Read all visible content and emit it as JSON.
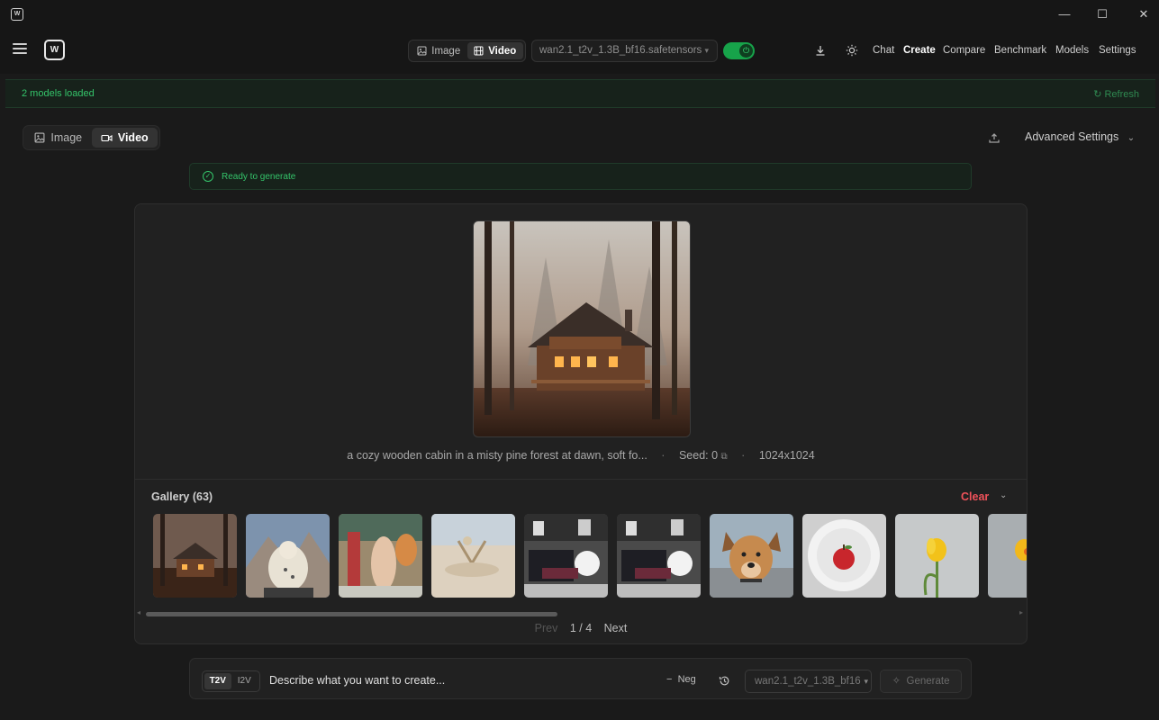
{
  "window": {
    "minimize": "—",
    "maximize": "☐",
    "close": "✕"
  },
  "brand": {
    "logo_text": "W"
  },
  "topnav": {
    "mode_tabs": [
      {
        "label": "Image"
      },
      {
        "label": "Video",
        "active": true
      }
    ],
    "model": "wan2.1_t2v_1.3B_bf16.safetensors",
    "power_on": true,
    "links": [
      {
        "label": "Chat"
      },
      {
        "label": "Create",
        "active": true
      },
      {
        "label": "Compare"
      },
      {
        "label": "Benchmark"
      },
      {
        "label": "Models"
      },
      {
        "label": "Settings"
      }
    ]
  },
  "status": {
    "message": "2 models loaded",
    "refresh_label": "Refresh"
  },
  "subbar": {
    "tabs": [
      {
        "label": "Image"
      },
      {
        "label": "Video",
        "active": true
      }
    ],
    "advanced_settings": "Advanced Settings"
  },
  "ready": {
    "message": "Ready to generate"
  },
  "preview": {
    "prompt": "a cozy wooden cabin in a misty pine forest at dawn, soft fo...",
    "seed_label": "Seed: 0",
    "resolution": "1024x1024"
  },
  "gallery": {
    "title": "Gallery (63)",
    "clear_label": "Clear",
    "pagination": {
      "prev": "Prev",
      "page": "1 / 4",
      "next": "Next"
    }
  },
  "prompt_bar": {
    "modes": [
      {
        "label": "T2V",
        "active": true
      },
      {
        "label": "I2V"
      }
    ],
    "placeholder": "Describe what you want to create...",
    "neg_label": "Neg",
    "model": "wan2.1_t2v_1.3B_bf16",
    "generate_label": "Generate"
  },
  "colors": {
    "accent_green": "#34c46a",
    "toggle_green": "#17a34a",
    "danger_red": "#f0525a",
    "background": "#1a1a1a",
    "card": "#212121"
  }
}
